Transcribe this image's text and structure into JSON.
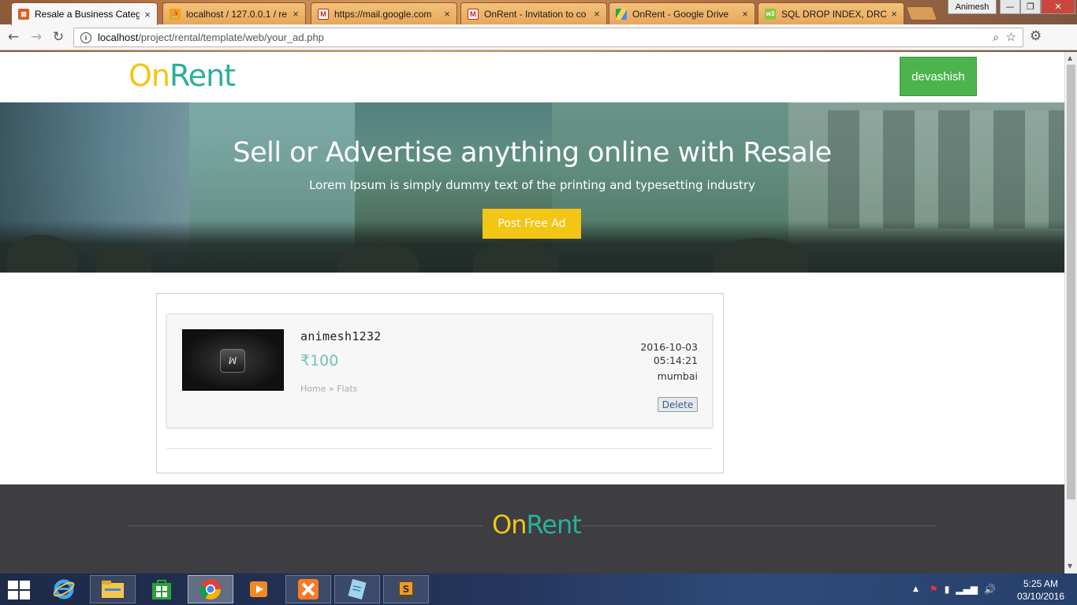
{
  "browser": {
    "tabs": [
      {
        "title": "Resale a Business Catego",
        "active": true,
        "icon": "xampp-icon"
      },
      {
        "title": "localhost / 127.0.0.1 / re",
        "active": false,
        "icon": "phpmyadmin-icon"
      },
      {
        "title": "https://mail.google.com",
        "active": false,
        "icon": "gmail-icon"
      },
      {
        "title": "OnRent - Invitation to co",
        "active": false,
        "icon": "gmail-icon"
      },
      {
        "title": "OnRent - Google Drive",
        "active": false,
        "icon": "google-drive-icon"
      },
      {
        "title": "SQL DROP INDEX, DROP",
        "active": false,
        "icon": "w3schools-icon"
      }
    ],
    "profile_name": "Animesh",
    "url_host": "localhost",
    "url_path": "/project/rental/template/web/your_ad.php"
  },
  "site": {
    "logo_on": "On",
    "logo_rent": "Rent",
    "user_button": "devashish",
    "hero_title": "Sell or Advertise anything online with Resale",
    "hero_subtitle": "Lorem Ipsum is simply dummy text of the printing and typesetting industry",
    "post_ad_button": "Post Free Ad"
  },
  "ad": {
    "name": "animesh1232",
    "price": "₹100",
    "breadcrumb": "Home » Flats",
    "date": "2016-10-03",
    "time": "05:14:21",
    "location": "mumbai",
    "delete_label": "Delete"
  },
  "taskbar": {
    "apps": [
      "internet-explorer-icon",
      "file-explorer-icon",
      "store-icon",
      "chrome-icon",
      "media-player-icon",
      "xampp-icon",
      "notepad-icon",
      "sublime-text-icon"
    ],
    "time": "5:25 AM",
    "date": "03/10/2016"
  },
  "colors": {
    "logo_yellow": "#f3c515",
    "logo_teal": "#2bb09a",
    "user_green": "#4db34d",
    "price_teal": "#6fc3b4",
    "footer_bg": "#3d3d42"
  }
}
